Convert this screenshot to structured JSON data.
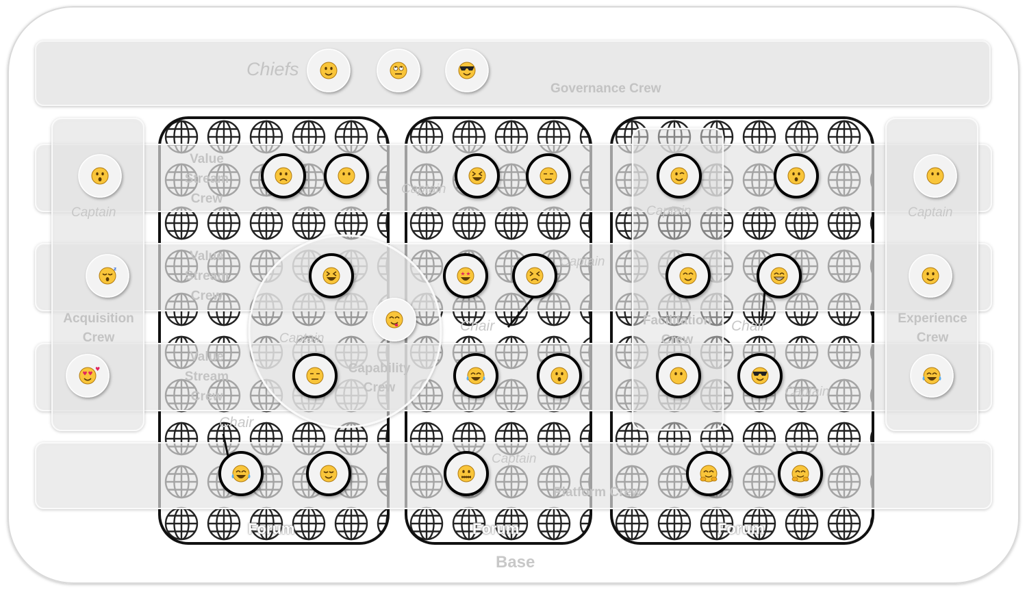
{
  "labels": {
    "chiefs": "Chiefs",
    "governance_crew": "Governance Crew",
    "value_stream_crew": "Value Stream Crew",
    "acquisition_crew": "Acquisition Crew",
    "experience_crew": "Experience Crew",
    "facilitation_crew": "Facilitation Crew",
    "capability_crew": "Capability Crew",
    "platform_crew": "Platform Crew",
    "captain": "Captain",
    "chair": "Chair",
    "forum": "Forum",
    "base": "Base"
  },
  "colors": {
    "band_fill": "#e9e9e9",
    "band_stroke": "#f7f7f7",
    "forum_stroke": "#111111",
    "globe_stroke": "#222222",
    "label_text": "#c3c3c3",
    "emoji_face": "#f9c53a",
    "emoji_disc": "#f3f3f3"
  },
  "chiefs": [
    {
      "icon": "smiling-face-icon"
    },
    {
      "icon": "eye-roll-face-icon"
    },
    {
      "icon": "sunglasses-face-icon"
    }
  ],
  "forums": [
    {
      "members": [
        "frowning-face-icon",
        "blank-face-icon",
        "grinning-squint-face-icon",
        "expressionless-face-icon",
        "joy-face-icon",
        "sleepy-face-icon"
      ]
    },
    {
      "members": [
        "laughing-face-icon",
        "expressionless-face-icon",
        "star-struck-face-icon",
        "persevere-face-icon",
        "rofl-face-icon",
        "hushed-face-icon",
        "zipper-mouth-face-icon"
      ]
    },
    {
      "members": [
        "winking-face-icon",
        "hushed-face-icon",
        "blush-face-icon",
        "grin-face-icon",
        "blank-face-icon",
        "sunglasses-face-icon",
        "hugging-face-icon",
        "hugging-face-icon"
      ]
    }
  ],
  "side_crews": [
    {
      "members": [
        "hushed-face-icon",
        "sleeping-face-icon",
        "heart-eyes-face-icon"
      ]
    },
    {
      "members": [
        "blank-face-icon",
        "smiling-face-icon",
        "joy-face-icon"
      ]
    }
  ],
  "capability_captain": {
    "icon": "yum-face-icon"
  }
}
